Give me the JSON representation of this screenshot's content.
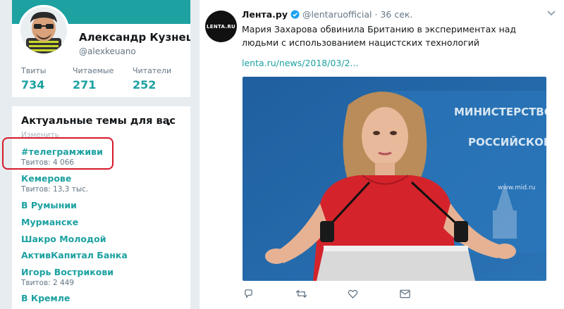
{
  "profile": {
    "name": "Александр Кузнецов",
    "handle": "@alexkeuano",
    "stats": [
      {
        "label": "Твиты",
        "value": "734"
      },
      {
        "label": "Читаемые",
        "value": "271"
      },
      {
        "label": "Читатели",
        "value": "252"
      }
    ]
  },
  "trends": {
    "title": "Актуальные темы для вас",
    "change_label": "Изменить",
    "items": [
      {
        "name": "#телеграмживи",
        "count": "Твитов: 4 066"
      },
      {
        "name": "Кемерове",
        "count": "Твитов: 13,3 тыс."
      },
      {
        "name": "В Румынии",
        "count": ""
      },
      {
        "name": "Мурманске",
        "count": ""
      },
      {
        "name": "Шакро Молодой",
        "count": ""
      },
      {
        "name": "АктивКапитал Банка",
        "count": ""
      },
      {
        "name": "Игорь Вострикови",
        "count": "Твитов: 2 449"
      },
      {
        "name": "В Кремле",
        "count": ""
      }
    ]
  },
  "tweet": {
    "avatar_text": "LENTA.RU",
    "author": "Лента.ру",
    "handle": "@lentaruofficial",
    "separator": "·",
    "time": "36 сек.",
    "text": "Мария Захарова обвинила Британию в экспериментах над людьми с использованием нацистских технологий",
    "link": "lenta.ru/news/2018/03/2...",
    "image_sign": [
      "МИНИСТЕРСТВО ИНОСТРАННЫХ ДЕЛ",
      "РОССИЙСКОЙ ФЕДЕРАЦИИ"
    ],
    "image_url": "www.mid.ru"
  },
  "colors": {
    "accent": "#1da1a1",
    "highlight": "#d51a2a"
  },
  "icons": [
    "verified-icon",
    "caret-down-icon",
    "reply-icon",
    "retweet-icon",
    "like-icon",
    "message-icon"
  ]
}
